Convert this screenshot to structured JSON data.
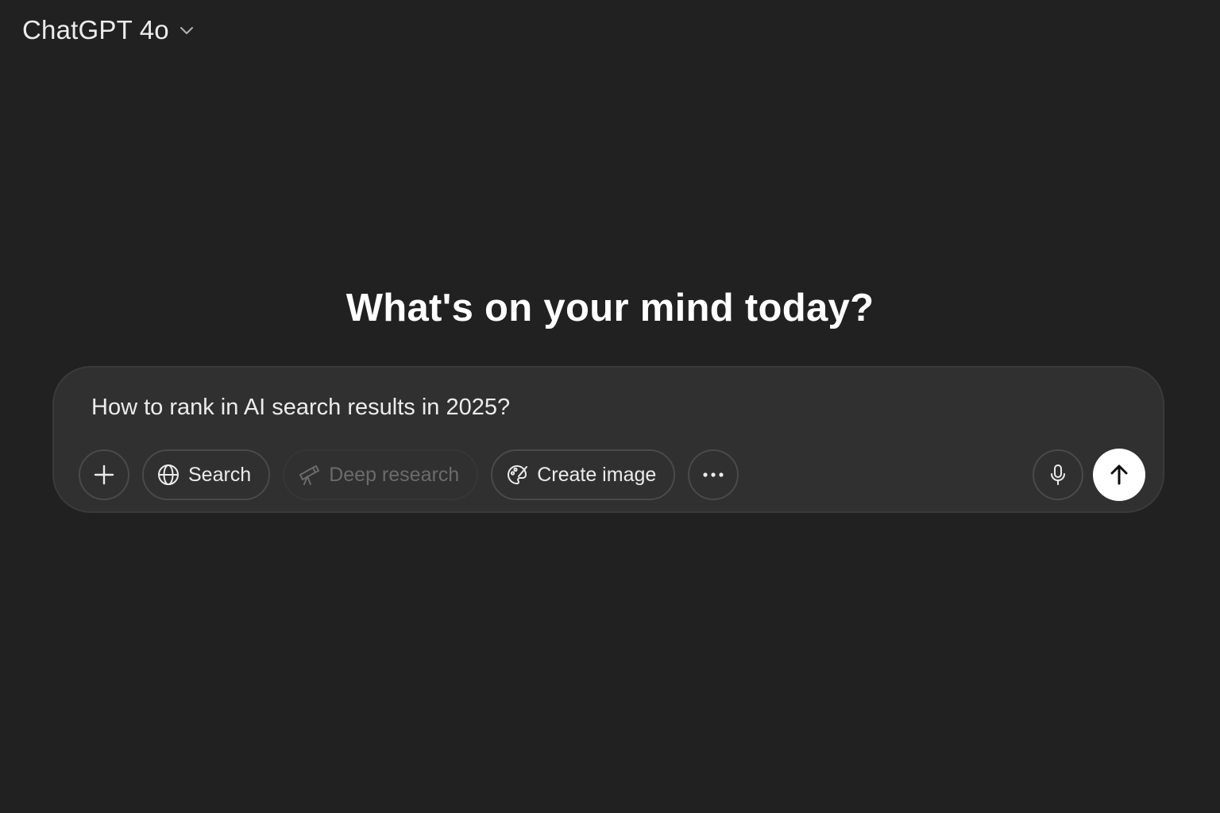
{
  "header": {
    "model_name": "ChatGPT 4o",
    "model_dropdown_icon": "chevron-down-icon"
  },
  "main": {
    "headline": "What's on your mind today?"
  },
  "composer": {
    "input_value": "How to rank in AI search results in 2025?",
    "tools": {
      "add": {
        "icon": "plus-icon"
      },
      "search": {
        "label": "Search",
        "icon": "globe-icon"
      },
      "deep_research": {
        "label": "Deep research",
        "icon": "telescope-icon",
        "state": "disabled"
      },
      "create_image": {
        "label": "Create image",
        "icon": "palette-icon"
      },
      "more": {
        "icon": "ellipsis-icon"
      }
    },
    "voice": {
      "icon": "microphone-icon"
    },
    "send": {
      "icon": "arrow-up-icon"
    }
  },
  "colors": {
    "background": "#212121",
    "composer_background": "#303030",
    "text": "#ececec",
    "disabled_text": "#6b6b6b",
    "send_button": "#ffffff"
  }
}
